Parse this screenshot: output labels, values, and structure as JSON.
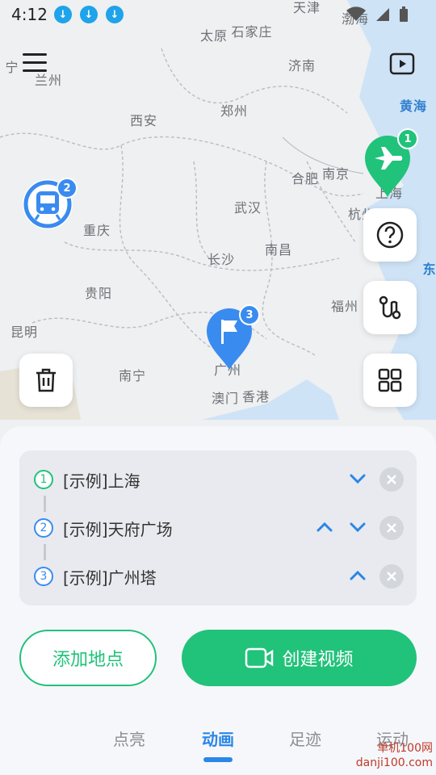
{
  "status_bar": {
    "time": "4:12",
    "download_glyph": "↓"
  },
  "map": {
    "cities": [
      {
        "name": "太原"
      },
      {
        "name": "石家庄"
      },
      {
        "name": "济南"
      },
      {
        "name": "西安"
      },
      {
        "name": "郑州"
      },
      {
        "name": "兰州"
      },
      {
        "name": "合肥"
      },
      {
        "name": "南京"
      },
      {
        "name": "上海"
      },
      {
        "name": "武汉"
      },
      {
        "name": "杭州"
      },
      {
        "name": "重庆"
      },
      {
        "name": "长沙"
      },
      {
        "name": "南昌"
      },
      {
        "name": "贵阳"
      },
      {
        "name": "福州"
      },
      {
        "name": "昆明"
      },
      {
        "name": "南宁"
      },
      {
        "name": "广州"
      },
      {
        "name": "澳门"
      },
      {
        "name": "香港"
      },
      {
        "name": "宁"
      },
      {
        "name": "天津"
      },
      {
        "name": "渤海"
      }
    ],
    "seas": [
      {
        "name": "黄海"
      },
      {
        "name": "东"
      }
    ],
    "markers": [
      {
        "icon": "airplane-icon",
        "badge": "1",
        "color": "#21c27a"
      },
      {
        "icon": "train-icon",
        "badge": "2",
        "color": "#3a8bef"
      },
      {
        "icon": "flag-icon",
        "badge": "3",
        "color": "#3a8bef"
      }
    ]
  },
  "route_list": [
    {
      "index": "1",
      "name": "[示例]上海",
      "color": "#21c27a"
    },
    {
      "index": "2",
      "name": "[示例]天府广场",
      "color": "#3a8bef"
    },
    {
      "index": "3",
      "name": "[示例]广州塔",
      "color": "#3a8bef"
    }
  ],
  "buttons": {
    "add_location": "添加地点",
    "create_video": "创建视频"
  },
  "tabs": [
    {
      "label": "点亮",
      "active": false
    },
    {
      "label": "动画",
      "active": true
    },
    {
      "label": "足迹",
      "active": false
    },
    {
      "label": "运动",
      "active": false
    }
  ],
  "watermark": "单机100网\ndanji100.com",
  "colors": {
    "accent_green": "#21c27a",
    "accent_blue": "#3a8bef",
    "tab_active": "#2a86e8"
  }
}
